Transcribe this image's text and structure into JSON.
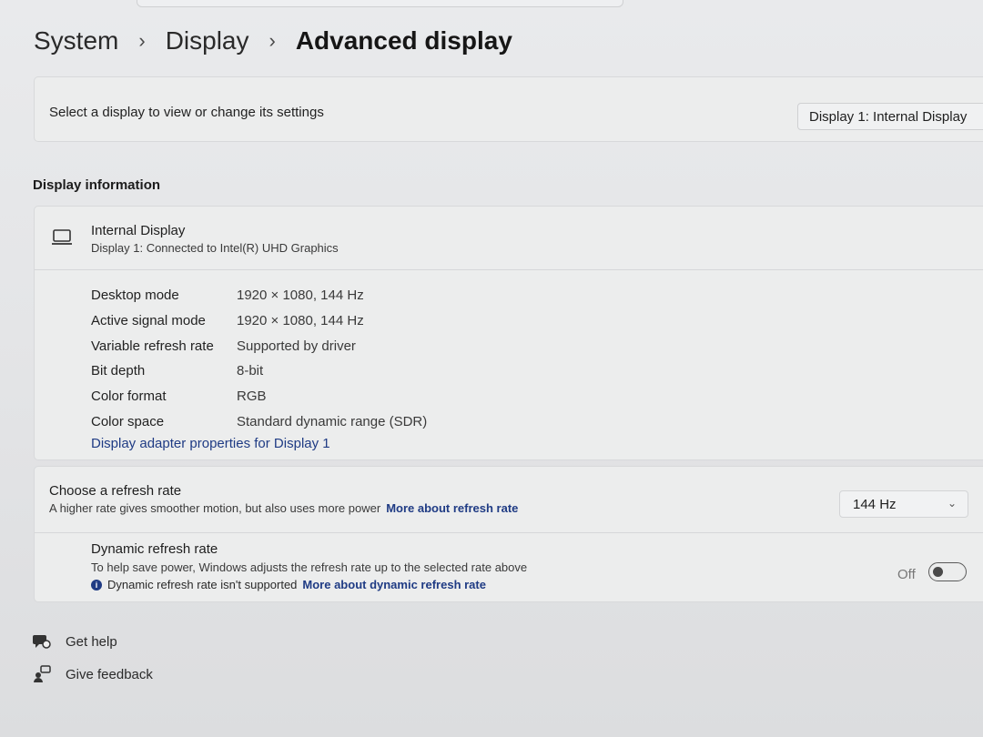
{
  "breadcrumb": {
    "items": [
      "System",
      "Display",
      "Advanced display"
    ],
    "separator": "›"
  },
  "display_select": {
    "label": "Select a display to view or change its settings",
    "selected": "Display 1: Internal Display"
  },
  "display_info": {
    "section_title": "Display information",
    "name": "Internal Display",
    "subtitle": "Display 1: Connected to Intel(R) UHD Graphics",
    "icon": "laptop-icon",
    "rows": [
      {
        "key": "Desktop mode",
        "value": "1920 × 1080, 144 Hz"
      },
      {
        "key": "Active signal mode",
        "value": "1920 × 1080, 144 Hz"
      },
      {
        "key": "Variable refresh rate",
        "value": "Supported by driver"
      },
      {
        "key": "Bit depth",
        "value": "8-bit"
      },
      {
        "key": "Color format",
        "value": "RGB"
      },
      {
        "key": "Color space",
        "value": "Standard dynamic range (SDR)"
      }
    ],
    "adapter_link": "Display adapter properties for Display 1"
  },
  "refresh": {
    "title": "Choose a refresh rate",
    "description": "A higher rate gives smoother motion, but also uses more power",
    "link": "More about refresh rate",
    "selected_rate": "144 Hz"
  },
  "dynamic_refresh": {
    "title": "Dynamic refresh rate",
    "description": "To help save power, Windows adjusts the refresh rate up to the selected rate above",
    "note": "Dynamic refresh rate isn't supported",
    "note_link": "More about dynamic refresh rate",
    "toggle_label": "Off",
    "toggle_on": false
  },
  "help": {
    "get_help": "Get help",
    "give_feedback": "Give feedback"
  },
  "colors": {
    "link": "#1f3b84",
    "card": "#eceded"
  }
}
